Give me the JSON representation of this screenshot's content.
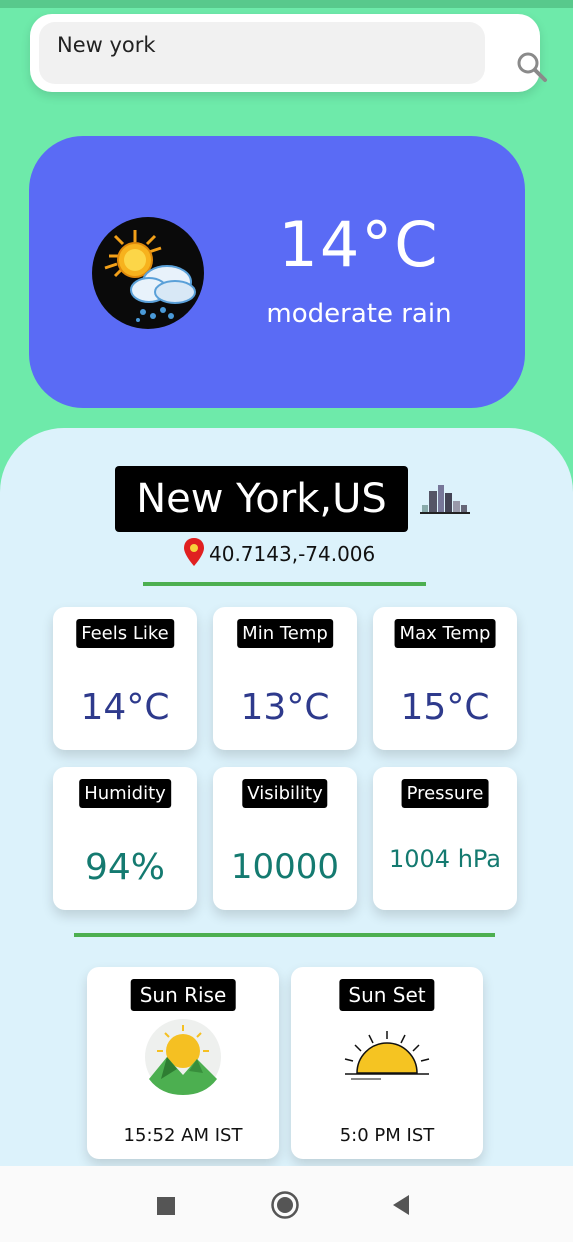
{
  "search": {
    "value": "New york",
    "icon": "search-icon"
  },
  "current": {
    "temperature": "14°C",
    "description": "moderate rain",
    "icon": "sun-cloud-rain-icon"
  },
  "location": {
    "city": "New York,US",
    "coordinates": "40.7143,-74.006",
    "city_icon": "city-skyline-icon",
    "pin_icon": "location-pin-icon"
  },
  "stats": [
    {
      "label": "Feels Like",
      "value": "14°C"
    },
    {
      "label": "Min Temp",
      "value": "13°C"
    },
    {
      "label": "Max Temp",
      "value": "15°C"
    },
    {
      "label": "Humidity",
      "value": "94%"
    },
    {
      "label": "Visibility",
      "value": "10000"
    },
    {
      "label": "Pressure",
      "value": "1004 hPa"
    }
  ],
  "sun": {
    "sunrise_label": "Sun Rise",
    "sunrise_time": "15:52 AM IST",
    "sunset_label": "Sun Set",
    "sunset_time": "5:0 PM IST"
  },
  "colors": {
    "background": "#6eeaaa",
    "hero": "#5a6bf5",
    "panel": "#dcf2fb",
    "divider": "#4caf50",
    "temp_value": "#2e3a8c",
    "stat_value": "#147a70"
  },
  "navbar": {
    "recents_icon": "square-icon",
    "home_icon": "circle-icon",
    "back_icon": "triangle-back-icon"
  }
}
